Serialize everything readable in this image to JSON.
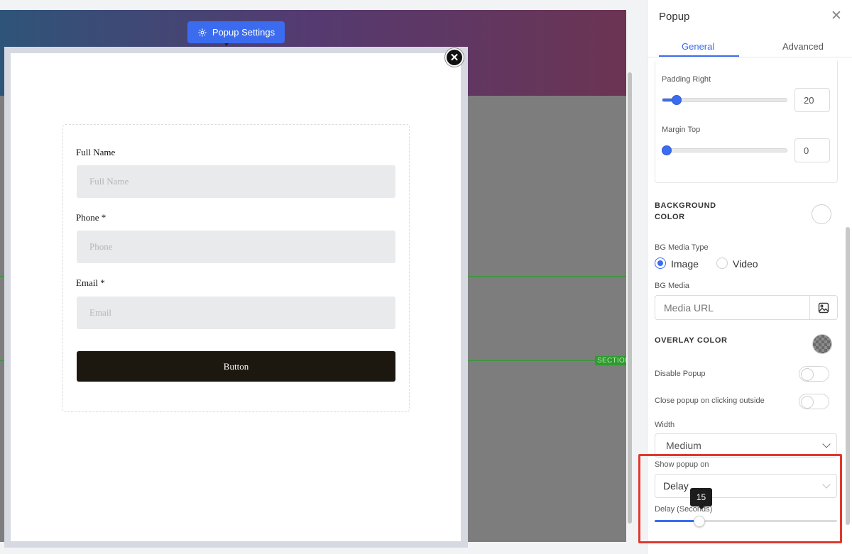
{
  "canvas": {
    "popup_settings_label": "Popup Settings",
    "section_tag": "SECTION",
    "form": {
      "fields": [
        {
          "label": "Full Name",
          "placeholder": "Full Name"
        },
        {
          "label": "Phone *",
          "placeholder": "Phone"
        },
        {
          "label": "Email *",
          "placeholder": "Email"
        }
      ],
      "button_label": "Button"
    }
  },
  "panel": {
    "title": "Popup",
    "tabs": [
      {
        "label": "General",
        "active": true
      },
      {
        "label": "Advanced",
        "active": false
      }
    ],
    "padding_right": {
      "label": "Padding Right",
      "value": "20",
      "fraction": 0.12
    },
    "margin_top": {
      "label": "Margin Top",
      "value": "0",
      "fraction": 0.0
    },
    "background_color": {
      "label_line1": "BACKGROUND",
      "label_line2": "COLOR"
    },
    "bg_media_type": {
      "label": "BG Media Type",
      "options": [
        "Image",
        "Video"
      ],
      "selected": "Image"
    },
    "bg_media": {
      "label": "BG Media",
      "placeholder": "Media URL"
    },
    "overlay_color": {
      "label": "OVERLAY COLOR"
    },
    "disable_popup": {
      "label": "Disable Popup",
      "on": false
    },
    "close_outside": {
      "label": "Close popup on clicking outside",
      "on": false
    },
    "width": {
      "label": "Width",
      "value": "Medium"
    },
    "show_popup_on": {
      "label": "Show popup on",
      "value": "Delay"
    },
    "delay": {
      "label": "Delay (Seconds)",
      "value": "15",
      "fraction": 0.25
    }
  },
  "icons": {
    "popup_settings": "gear-icon",
    "popup_close": "close-circle-icon",
    "panel_close": "close-icon",
    "media": "image-icon"
  },
  "colors": {
    "accent": "#3b6cf0",
    "form_button": "#1c1810",
    "highlight": "#e0382e",
    "guide": "#2e9b2e"
  }
}
